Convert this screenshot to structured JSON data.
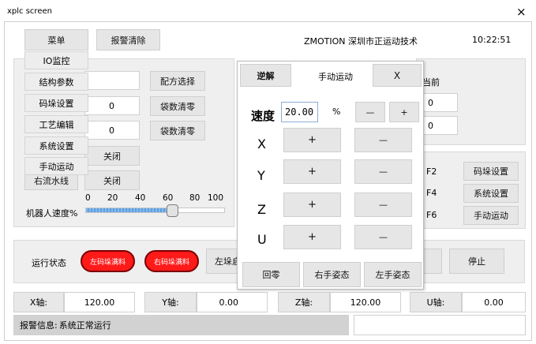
{
  "window": {
    "title": "xplc screen",
    "close": "×"
  },
  "header": {
    "menu": "菜单",
    "alarm_clear": "报警清除",
    "company": "ZMOTION  深圳市正运动技术",
    "time": "10:22:51"
  },
  "dropdown": [
    "IO监控",
    "结构参数",
    "码垛设置",
    "工艺编辑",
    "系统设置",
    "手动运动"
  ],
  "left_panel": {
    "recipe_select": "配方选择",
    "val1": "0",
    "bag_clear1": "袋数清零",
    "val2": "0",
    "bag_clear2": "袋数清零",
    "close1": "关闭",
    "right_line": "右流水线",
    "close2": "关闭",
    "ticks": [
      "0",
      "20",
      "40",
      "60",
      "80",
      "100"
    ],
    "speed_label": "机器人速度%",
    "speed_value_pct": 62
  },
  "right_panel": {
    "current": "当前",
    "val1": "0",
    "val2": "0",
    "keys": [
      {
        "key": "F2",
        "label": "码垛设置"
      },
      {
        "key": "F4",
        "label": "系统设置"
      },
      {
        "key": "F6",
        "label": "手动运动"
      }
    ]
  },
  "status": {
    "label": "运行状态",
    "left_full": "左码垛满料",
    "right_full": "右码垛满料",
    "left_stack": "左垛启",
    "stop": "停止"
  },
  "manual_dialog": {
    "tab_inverse": "逆解",
    "tab_manual": "手动运动",
    "tab_x": "X",
    "speed_label": "速度",
    "speed_value": "20.00",
    "percent": "%",
    "minus": "—",
    "plus": "+",
    "axes": [
      "X",
      "Y",
      "Z",
      "U"
    ],
    "home": "回零",
    "right_pose": "右手姿态",
    "left_pose": "左手姿态"
  },
  "axes_bar": [
    {
      "label": "X轴:",
      "value": "120.00"
    },
    {
      "label": "Y轴:",
      "value": "0.00"
    },
    {
      "label": "Z轴:",
      "value": "120.00"
    },
    {
      "label": "U轴:",
      "value": "0.00"
    }
  ],
  "alarm": {
    "label": "报警信息:",
    "text": "系统正常运行"
  }
}
